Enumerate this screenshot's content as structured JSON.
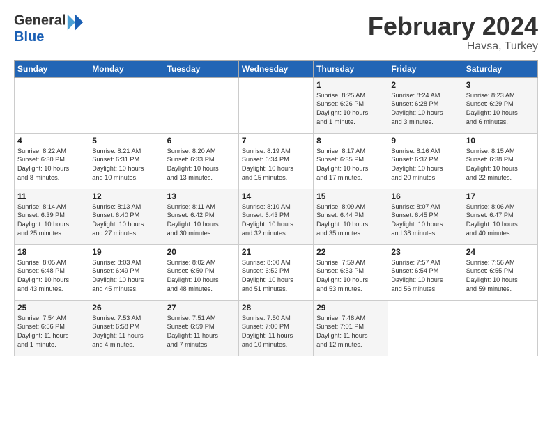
{
  "logo": {
    "general": "General",
    "blue": "Blue"
  },
  "title": {
    "month": "February 2024",
    "location": "Havsa, Turkey"
  },
  "headers": [
    "Sunday",
    "Monday",
    "Tuesday",
    "Wednesday",
    "Thursday",
    "Friday",
    "Saturday"
  ],
  "weeks": [
    [
      {
        "day": "",
        "detail": ""
      },
      {
        "day": "",
        "detail": ""
      },
      {
        "day": "",
        "detail": ""
      },
      {
        "day": "",
        "detail": ""
      },
      {
        "day": "1",
        "detail": "Sunrise: 8:25 AM\nSunset: 6:26 PM\nDaylight: 10 hours\nand 1 minute."
      },
      {
        "day": "2",
        "detail": "Sunrise: 8:24 AM\nSunset: 6:28 PM\nDaylight: 10 hours\nand 3 minutes."
      },
      {
        "day": "3",
        "detail": "Sunrise: 8:23 AM\nSunset: 6:29 PM\nDaylight: 10 hours\nand 6 minutes."
      }
    ],
    [
      {
        "day": "4",
        "detail": "Sunrise: 8:22 AM\nSunset: 6:30 PM\nDaylight: 10 hours\nand 8 minutes."
      },
      {
        "day": "5",
        "detail": "Sunrise: 8:21 AM\nSunset: 6:31 PM\nDaylight: 10 hours\nand 10 minutes."
      },
      {
        "day": "6",
        "detail": "Sunrise: 8:20 AM\nSunset: 6:33 PM\nDaylight: 10 hours\nand 13 minutes."
      },
      {
        "day": "7",
        "detail": "Sunrise: 8:19 AM\nSunset: 6:34 PM\nDaylight: 10 hours\nand 15 minutes."
      },
      {
        "day": "8",
        "detail": "Sunrise: 8:17 AM\nSunset: 6:35 PM\nDaylight: 10 hours\nand 17 minutes."
      },
      {
        "day": "9",
        "detail": "Sunrise: 8:16 AM\nSunset: 6:37 PM\nDaylight: 10 hours\nand 20 minutes."
      },
      {
        "day": "10",
        "detail": "Sunrise: 8:15 AM\nSunset: 6:38 PM\nDaylight: 10 hours\nand 22 minutes."
      }
    ],
    [
      {
        "day": "11",
        "detail": "Sunrise: 8:14 AM\nSunset: 6:39 PM\nDaylight: 10 hours\nand 25 minutes."
      },
      {
        "day": "12",
        "detail": "Sunrise: 8:13 AM\nSunset: 6:40 PM\nDaylight: 10 hours\nand 27 minutes."
      },
      {
        "day": "13",
        "detail": "Sunrise: 8:11 AM\nSunset: 6:42 PM\nDaylight: 10 hours\nand 30 minutes."
      },
      {
        "day": "14",
        "detail": "Sunrise: 8:10 AM\nSunset: 6:43 PM\nDaylight: 10 hours\nand 32 minutes."
      },
      {
        "day": "15",
        "detail": "Sunrise: 8:09 AM\nSunset: 6:44 PM\nDaylight: 10 hours\nand 35 minutes."
      },
      {
        "day": "16",
        "detail": "Sunrise: 8:07 AM\nSunset: 6:45 PM\nDaylight: 10 hours\nand 38 minutes."
      },
      {
        "day": "17",
        "detail": "Sunrise: 8:06 AM\nSunset: 6:47 PM\nDaylight: 10 hours\nand 40 minutes."
      }
    ],
    [
      {
        "day": "18",
        "detail": "Sunrise: 8:05 AM\nSunset: 6:48 PM\nDaylight: 10 hours\nand 43 minutes."
      },
      {
        "day": "19",
        "detail": "Sunrise: 8:03 AM\nSunset: 6:49 PM\nDaylight: 10 hours\nand 45 minutes."
      },
      {
        "day": "20",
        "detail": "Sunrise: 8:02 AM\nSunset: 6:50 PM\nDaylight: 10 hours\nand 48 minutes."
      },
      {
        "day": "21",
        "detail": "Sunrise: 8:00 AM\nSunset: 6:52 PM\nDaylight: 10 hours\nand 51 minutes."
      },
      {
        "day": "22",
        "detail": "Sunrise: 7:59 AM\nSunset: 6:53 PM\nDaylight: 10 hours\nand 53 minutes."
      },
      {
        "day": "23",
        "detail": "Sunrise: 7:57 AM\nSunset: 6:54 PM\nDaylight: 10 hours\nand 56 minutes."
      },
      {
        "day": "24",
        "detail": "Sunrise: 7:56 AM\nSunset: 6:55 PM\nDaylight: 10 hours\nand 59 minutes."
      }
    ],
    [
      {
        "day": "25",
        "detail": "Sunrise: 7:54 AM\nSunset: 6:56 PM\nDaylight: 11 hours\nand 1 minute."
      },
      {
        "day": "26",
        "detail": "Sunrise: 7:53 AM\nSunset: 6:58 PM\nDaylight: 11 hours\nand 4 minutes."
      },
      {
        "day": "27",
        "detail": "Sunrise: 7:51 AM\nSunset: 6:59 PM\nDaylight: 11 hours\nand 7 minutes."
      },
      {
        "day": "28",
        "detail": "Sunrise: 7:50 AM\nSunset: 7:00 PM\nDaylight: 11 hours\nand 10 minutes."
      },
      {
        "day": "29",
        "detail": "Sunrise: 7:48 AM\nSunset: 7:01 PM\nDaylight: 11 hours\nand 12 minutes."
      },
      {
        "day": "",
        "detail": ""
      },
      {
        "day": "",
        "detail": ""
      }
    ]
  ]
}
